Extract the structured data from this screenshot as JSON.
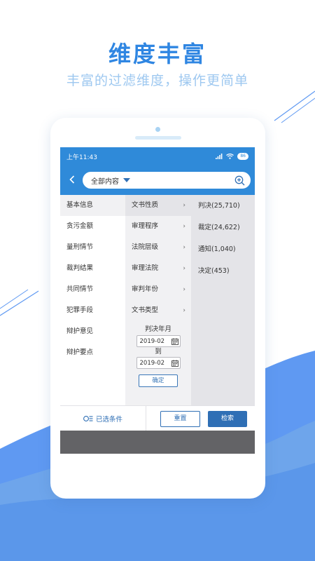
{
  "promo": {
    "headline": "维度丰富",
    "subline": "丰富的过滤维度，操作更简单"
  },
  "colors": {
    "brand_blue": "#2f8ad9",
    "button_blue": "#2f6fb5",
    "wave_blue": "#6ea3f5"
  },
  "status_bar": {
    "time": "上午11:43",
    "battery": "86"
  },
  "search": {
    "back_icon": "chevron-left-icon",
    "scope_label": "全部内容",
    "search_icon": "zoom-search-icon"
  },
  "categories": [
    {
      "label": "基本信息"
    },
    {
      "label": "贪污金额"
    },
    {
      "label": "量刑情节"
    },
    {
      "label": "裁判结果"
    },
    {
      "label": "共同情节"
    },
    {
      "label": "犯罪手段"
    },
    {
      "label": "辩护意见"
    },
    {
      "label": "辩护要点"
    }
  ],
  "subcategories": [
    {
      "label": "文书性质"
    },
    {
      "label": "审理程序"
    },
    {
      "label": "法院层级"
    },
    {
      "label": "审理法院"
    },
    {
      "label": "审判年份"
    },
    {
      "label": "文书类型"
    }
  ],
  "options": [
    {
      "label": "判决(25,710)"
    },
    {
      "label": "裁定(24,622)"
    },
    {
      "label": "通知(1,040)"
    },
    {
      "label": "决定(453)"
    }
  ],
  "date_filter": {
    "label": "判决年月",
    "from_value": "2019-02",
    "to_label": "到",
    "to_value": "2019-02",
    "confirm_label": "确定"
  },
  "bottom_bar": {
    "selected_label": "已选条件",
    "reset_label": "重置",
    "search_label": "检索"
  }
}
